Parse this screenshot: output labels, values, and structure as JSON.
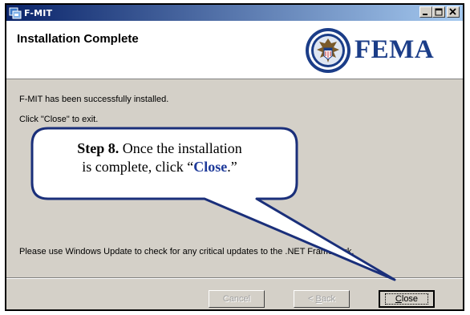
{
  "window": {
    "title": "F-MIT",
    "min_label": "_",
    "max_label": "□",
    "close_label": "×"
  },
  "header": {
    "title": "Installation Complete",
    "brand": "FEMA"
  },
  "body": {
    "line1": "F-MIT has been successfully installed.",
    "line2": "Click \"Close\" to exit.",
    "line3": "Please use Windows Update to check for any critical updates to the .NET Framework."
  },
  "callout": {
    "step": "Step 8.",
    "text1": " Once the installation",
    "text2": "is complete, click “",
    "close_word": "Close",
    "text3": ".”"
  },
  "buttons": {
    "cancel": "Cancel",
    "back_prefix": "< ",
    "back_u": "B",
    "back_rest": "ack",
    "close_u": "C",
    "close_rest": "lose"
  },
  "colors": {
    "titlebar": "#0a246a",
    "brand": "#1b3d88",
    "callout_border": "#1a2f7a",
    "face": "#d4d0c8"
  }
}
